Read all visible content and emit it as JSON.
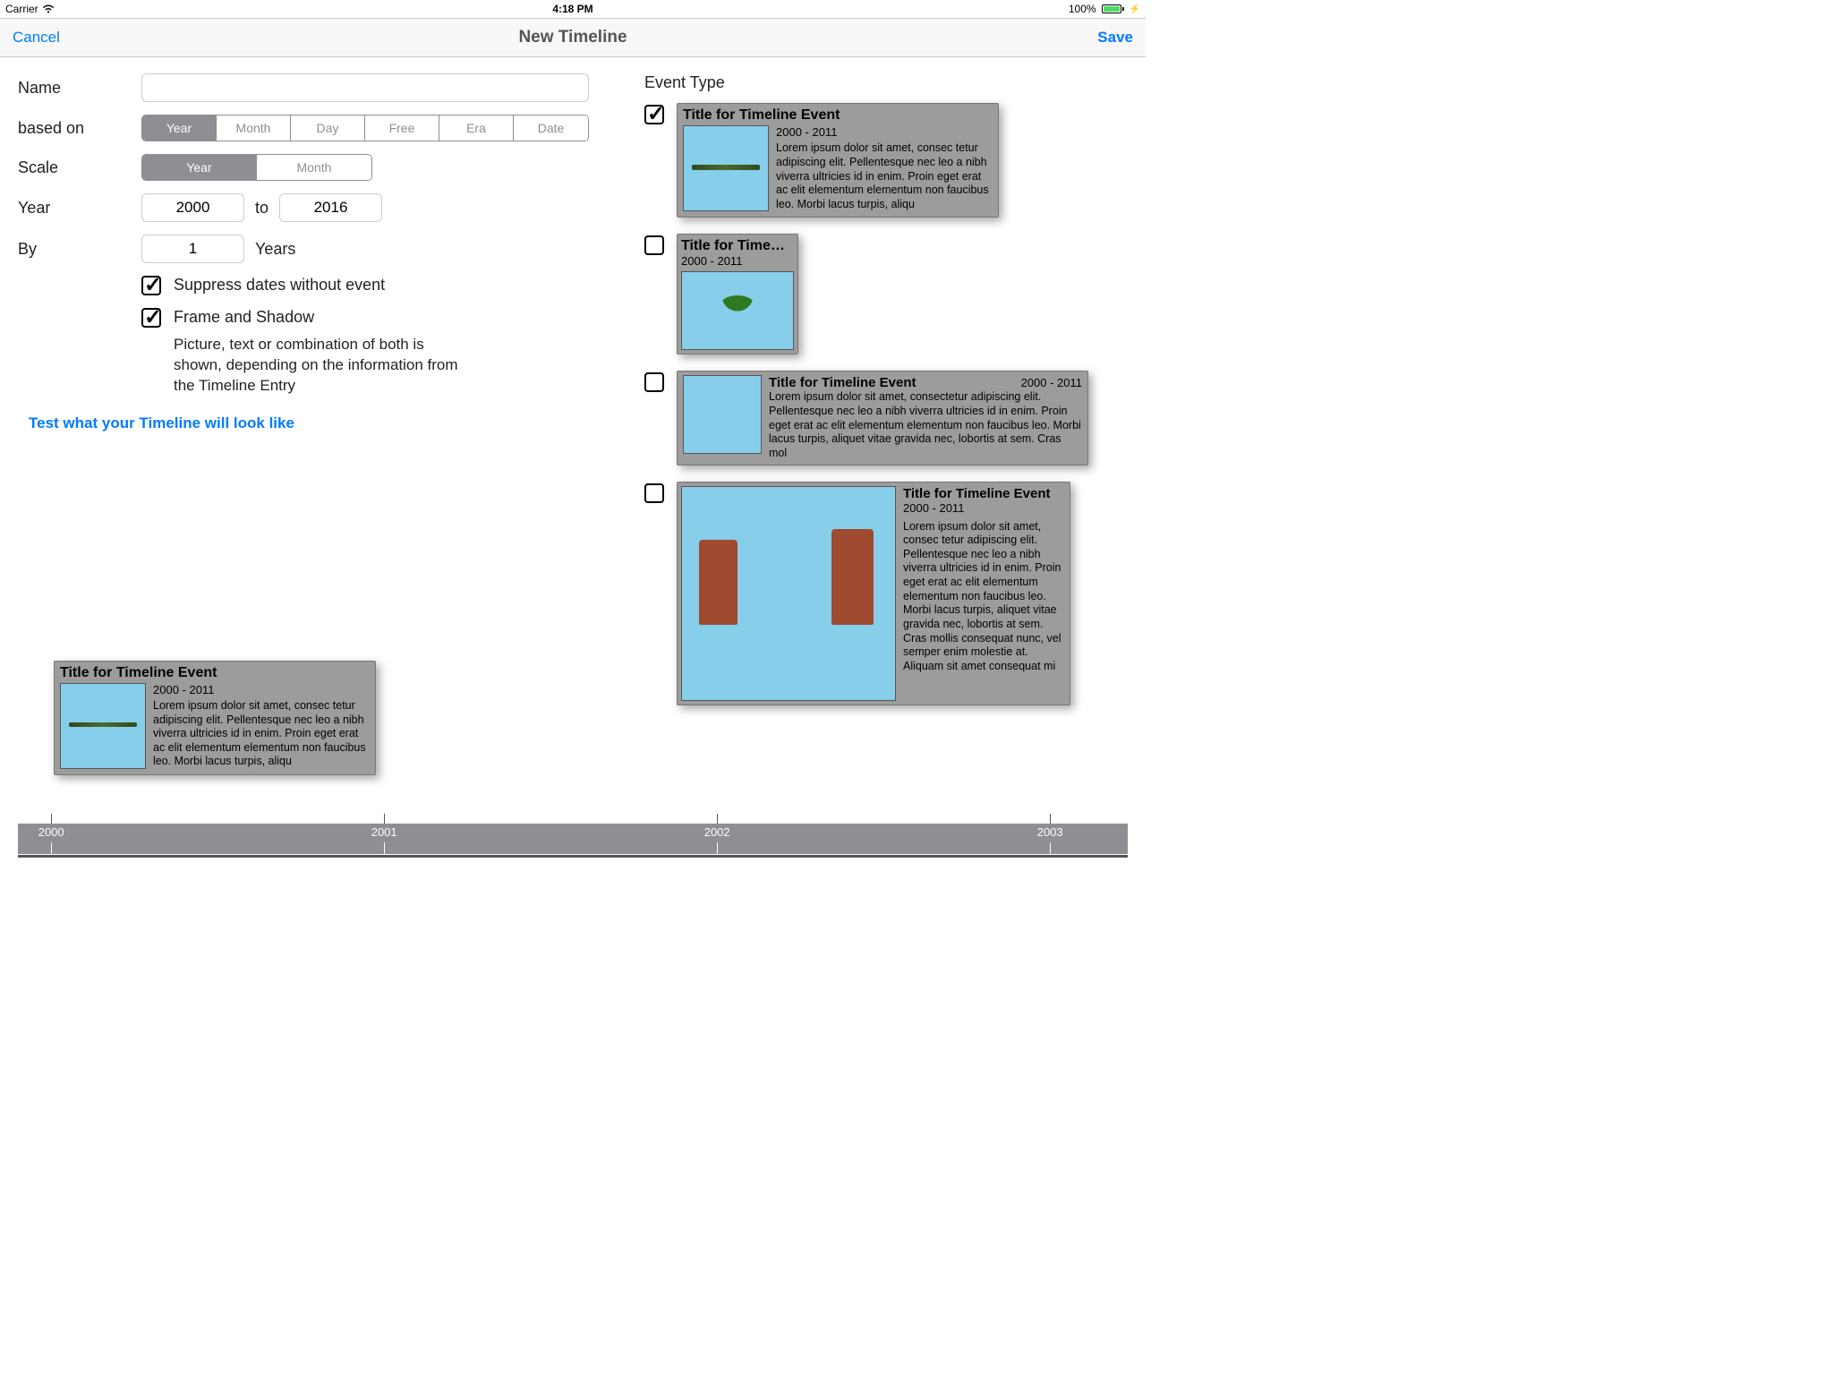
{
  "status": {
    "carrier": "Carrier",
    "time": "4:18 PM",
    "battery_pct": "100%"
  },
  "nav": {
    "cancel": "Cancel",
    "title": "New Timeline",
    "save": "Save"
  },
  "form": {
    "labels": {
      "name": "Name",
      "based_on": "based on",
      "scale": "Scale",
      "year": "Year",
      "to": "to",
      "by": "By",
      "by_unit": "Years"
    },
    "name_value": "",
    "based_on_options": [
      "Year",
      "Month",
      "Day",
      "Free",
      "Era",
      "Date"
    ],
    "based_on_selected": "Year",
    "scale_options": [
      "Year",
      "Month"
    ],
    "scale_selected": "Year",
    "year_from": "2000",
    "year_to": "2016",
    "by_value": "1",
    "suppress_label": "Suppress dates without event",
    "frame_label": "Frame and Shadow",
    "note": "Picture, text  or combination of both is shown, depending on the information from the Timeline Entry",
    "test_link": "Test what your Timeline will look like"
  },
  "right": {
    "heading": "Event Type",
    "card_title": "Title for Timeline Event",
    "card_title_trunc": "Title for Time…",
    "dates": "2000 - 2011",
    "lorem_short": "Lorem ipsum dolor sit amet, consec tetur adipiscing elit. Pellentesque nec leo a nibh viverra ultricies id in enim. Proin eget erat ac elit elementum elementum non faucibus leo. Morbi lacus turpis, aliqu",
    "lorem_wide": "Lorem ipsum dolor sit amet, consectetur adipiscing elit. Pellentesque nec leo a nibh viverra ultricies id in enim. Proin eget erat ac elit elementum elementum non faucibus leo. Morbi lacus turpis, aliquet vitae gravida nec, lobortis at sem. Cras mol",
    "lorem_tall": "Lorem ipsum dolor sit amet, consec tetur adipiscing elit. Pellentesque nec leo a nibh viverra ultricies id in enim. Proin eget erat ac elit elementum elementum non faucibus leo. Morbi lacus turpis, aliquet vitae gravida nec, lobortis at sem. Cras mollis consequat nunc, vel semper enim molestie at. Aliquam sit amet consequat mi"
  },
  "timeline": {
    "years": [
      "2000",
      "2001",
      "2002",
      "2003"
    ]
  }
}
